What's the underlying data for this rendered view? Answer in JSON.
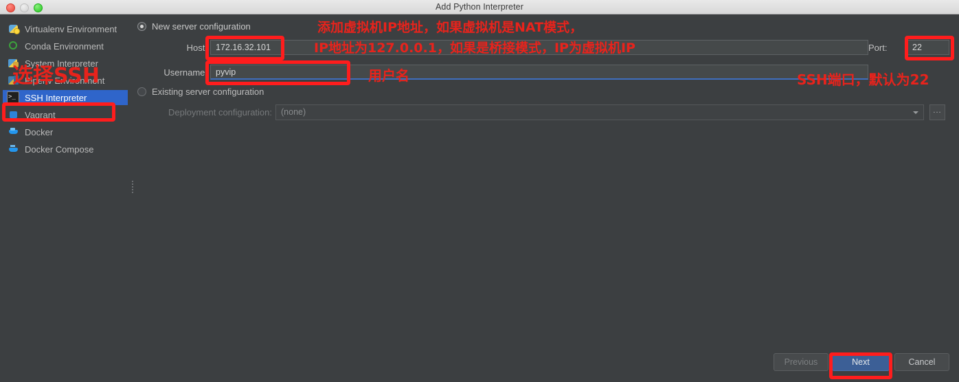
{
  "window": {
    "title": "Add Python Interpreter",
    "controls": {
      "close": "close-button",
      "minimize": "minimize-button",
      "maximize": "maximize-button"
    }
  },
  "sidebar": {
    "items": [
      {
        "label": "Virtualenv Environment",
        "icon": "virtualenv-icon",
        "selected": false
      },
      {
        "label": "Conda Environment",
        "icon": "conda-icon",
        "selected": false
      },
      {
        "label": "System Interpreter",
        "icon": "system-interpreter-icon",
        "selected": false
      },
      {
        "label": "Pipenv Environment",
        "icon": "pipenv-icon",
        "selected": false
      },
      {
        "label": "SSH Interpreter",
        "icon": "ssh-terminal-icon",
        "selected": true
      },
      {
        "label": "Vagrant",
        "icon": "vagrant-icon",
        "selected": false
      },
      {
        "label": "Docker",
        "icon": "docker-icon",
        "selected": false
      },
      {
        "label": "Docker Compose",
        "icon": "docker-compose-icon",
        "selected": false
      }
    ]
  },
  "panel": {
    "new_server_radio": "New server configuration",
    "existing_server_radio": "Existing server configuration",
    "host_label": "Host:",
    "host_value": "172.16.32.101",
    "username_label": "Username:",
    "username_value": "pyvip",
    "port_label": "Port:",
    "port_value": "22",
    "deployment_label": "Deployment configuration:",
    "deployment_value": "(none)",
    "browse_label": "..."
  },
  "footer": {
    "previous_label": "Previous",
    "next_label": "Next",
    "cancel_label": "Cancel"
  },
  "annotations": {
    "ip_line1": "添加虚拟机IP地址，如果虚拟机是NAT模式，",
    "ip_line2": "IP地址为127.0.0.1，如果是桥接模式，IP为虚拟机IP",
    "username": "用户名",
    "port": "SSH端口，默认为22",
    "select_ssh": "选择SSH"
  },
  "colors": {
    "background": "#3c3f41",
    "selection_blue": "#2f65ca",
    "annotation_red": "#e8231c",
    "primary_button": "#3c5f96"
  }
}
